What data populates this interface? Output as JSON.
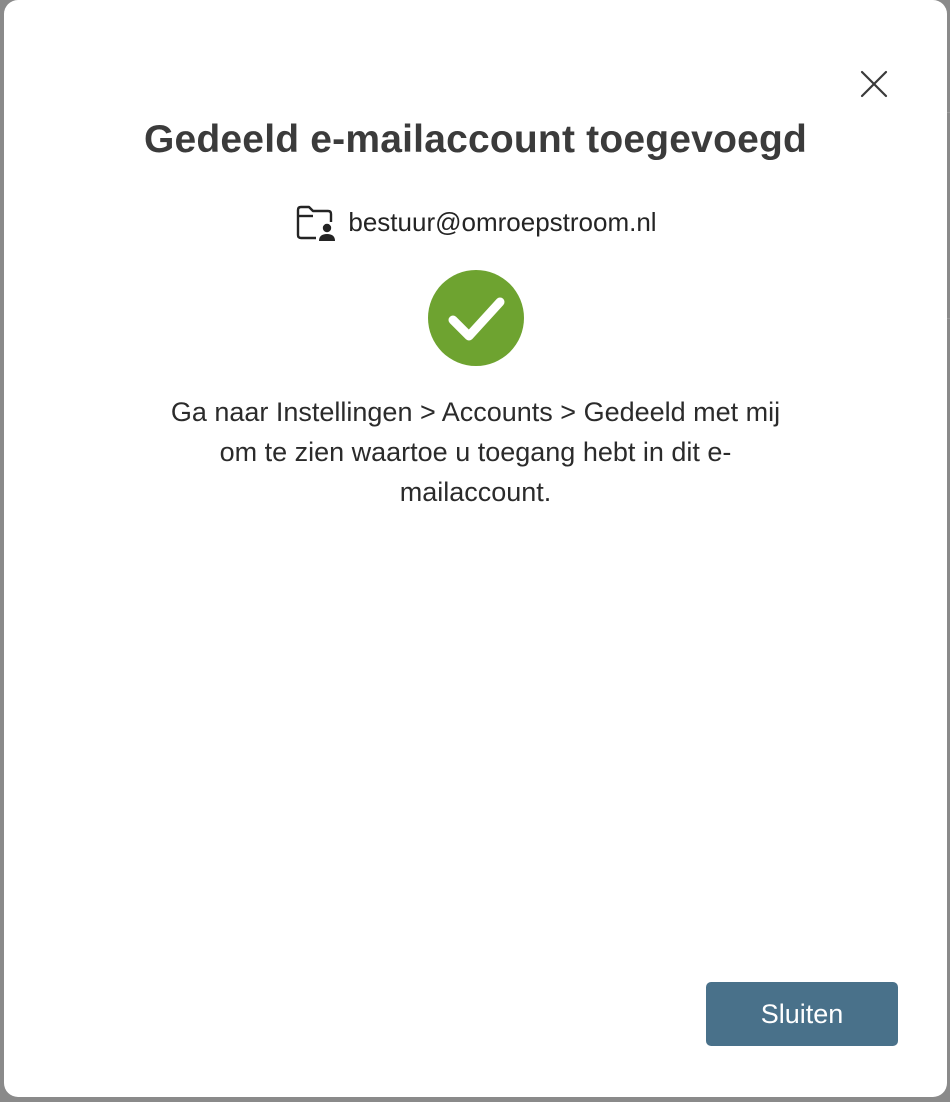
{
  "dialog": {
    "title": "Gedeeld e-mailaccount toegevoegd",
    "close_icon": "close-icon",
    "account": {
      "icon": "shared-folder-person-icon",
      "email": "bestuur@omroepstroom.nl"
    },
    "status_icon": "checkmark-circle-icon",
    "status_color": "#6ea330",
    "message": "Ga naar Instellingen > Accounts > Gedeeld met mij om te zien waartoe u toegang hebt in dit e-mailaccount.",
    "close_button_label": "Sluiten",
    "close_button_color": "#49718a"
  }
}
